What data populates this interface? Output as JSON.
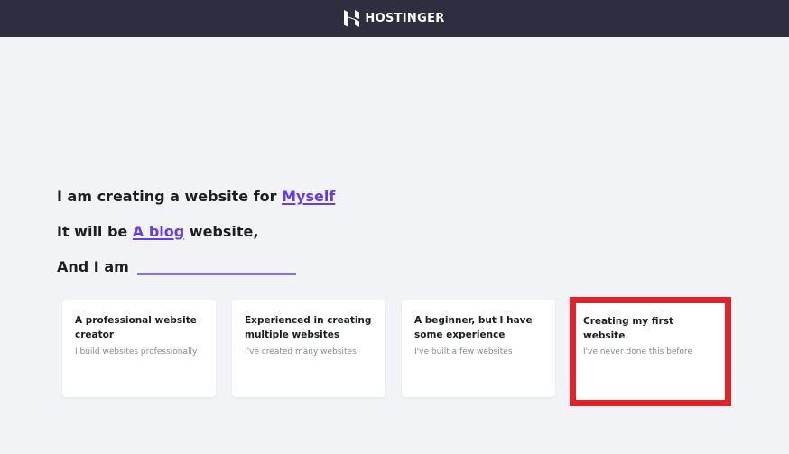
{
  "header": {
    "brand": "HOSTINGER"
  },
  "prompt": {
    "line1_prefix": "I am creating a website for",
    "line1_choice": "Myself",
    "line2_prefix": "It will be",
    "line2_choice": "A blog",
    "line2_suffix": "website,",
    "line3_prefix": "And I am"
  },
  "options": [
    {
      "title": "A professional website creator",
      "desc": "I build websites professionally"
    },
    {
      "title": "Experienced in creating multiple websites",
      "desc": "I've created many websites"
    },
    {
      "title": "A beginner, but I have some experience",
      "desc": "I've built a few websites"
    },
    {
      "title": "Creating my first website",
      "desc": "I've never done this before"
    }
  ],
  "colors": {
    "header_bg": "#2f2e41",
    "accent": "#673de6",
    "highlight": "#e0242b"
  }
}
